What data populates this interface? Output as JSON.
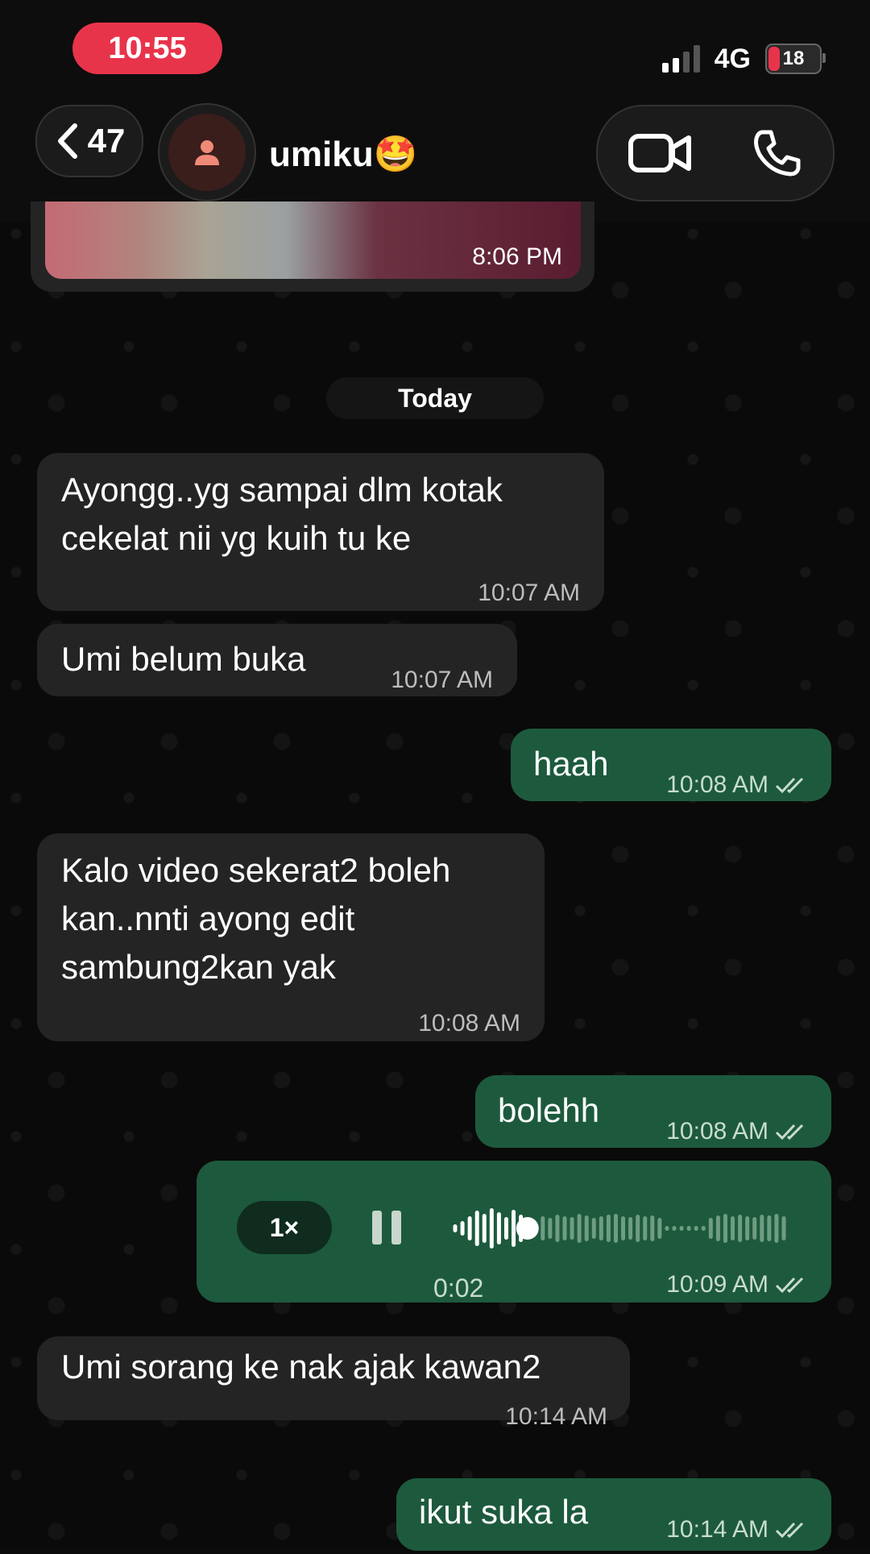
{
  "status_bar": {
    "time": "10:55",
    "network": "4G",
    "battery": "18"
  },
  "header": {
    "back_count": "47",
    "contact_name": "umiku🤩"
  },
  "image_message": {
    "time": "8:06 PM"
  },
  "date_divider": "Today",
  "messages": [
    {
      "dir": "in",
      "lines": [
        "Ayongg..yg sampai dlm kotak",
        "cekelat nii yg kuih tu ke"
      ],
      "time": "10:07 AM"
    },
    {
      "dir": "in",
      "lines": [
        "Umi belum buka"
      ],
      "time": "10:07 AM"
    },
    {
      "dir": "out",
      "lines": [
        "haah"
      ],
      "time": "10:08 AM"
    },
    {
      "dir": "in",
      "lines": [
        "Kalo video sekerat2 boleh",
        "kan..nnti ayong edit",
        "sambung2kan yak"
      ],
      "time": "10:08 AM"
    },
    {
      "dir": "out",
      "lines": [
        "bolehh"
      ],
      "time": "10:08 AM"
    },
    {
      "dir": "in",
      "lines": [
        "Umi sorang ke nak ajak kawan2"
      ],
      "time": "10:14 AM"
    },
    {
      "dir": "out",
      "lines": [
        "ikut suka la"
      ],
      "time": "10:14 AM"
    }
  ],
  "voice_message": {
    "speed": "1×",
    "duration": "0:02",
    "time": "10:09 AM",
    "progress": 0.22
  },
  "colors": {
    "outgoing": "#1d5a3d",
    "incoming": "#242424",
    "time_pill": "#e8344a"
  }
}
